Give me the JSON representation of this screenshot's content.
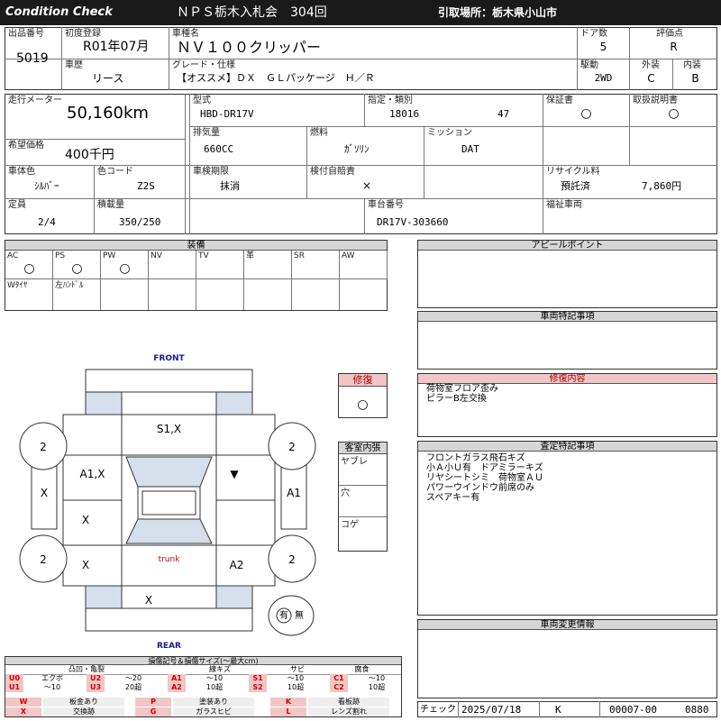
{
  "header": {
    "title": "Condition  Check",
    "auction": "ＮＰＳ栃木入札会　304回",
    "pickup": "引取場所：栃木県小山市"
  },
  "top": {
    "lot_label": "出品番号",
    "lot": "5019",
    "reg_label": "初度登録",
    "reg": "R01年07月",
    "name_label": "車種名",
    "name": "ＮＶ１００クリッパー",
    "doors_label": "ドア数",
    "doors": "5",
    "grade_score_label": "評価点",
    "grade_score": "R",
    "history_label": "車歴",
    "history": "リース",
    "grade_label": "グレード・仕様",
    "grade": "【オススメ】ＤＸ　ＧＬパッケージ　Ｈ／Ｒ",
    "drive_label": "駆動",
    "drive": "2WD",
    "exterior_label": "外装",
    "exterior": "C",
    "interior_label": "内装",
    "interior": "B"
  },
  "mid": {
    "mileage_label": "走行メーター",
    "mileage": "50,160km",
    "price_label": "希望価格",
    "price": "400千円",
    "model_label": "型式",
    "model": "HBD-DR17V",
    "designation_label": "指定・類別",
    "designation": "18016",
    "category": "47",
    "warranty_label": "保証書",
    "warranty": "○",
    "manual_label": "取扱説明書",
    "manual": "○",
    "displacement_label": "排気量",
    "displacement": "660CC",
    "fuel_label": "燃料",
    "fuel": "ｶﾞｿﾘﾝ",
    "mission_label": "ミッション",
    "mission": "DAT",
    "color_label": "車体色",
    "color": "ｼﾙﾊﾞｰ",
    "colorcode_label": "色コード",
    "colorcode": "Z2S",
    "inspection_label": "車検期限",
    "inspection": "抹消",
    "insurance_label": "検付自賠責",
    "insurance": "×",
    "recycle_label": "リサイクル料",
    "recycle_status": "預託済",
    "recycle_fee": "7,860円",
    "capacity_label": "定員",
    "capacity": "2/4",
    "load_label": "積載量",
    "load": "350/250",
    "chassis_label": "車台番号",
    "chassis": "DR17V-303660",
    "welfare_label": "福祉車両"
  },
  "equipment": {
    "title": "装備",
    "items": [
      {
        "label": "AC",
        "value": "○"
      },
      {
        "label": "PS",
        "value": "○"
      },
      {
        "label": "PW",
        "value": "○"
      },
      {
        "label": "NV",
        "value": ""
      },
      {
        "label": "TV",
        "value": ""
      },
      {
        "label": "革",
        "value": ""
      },
      {
        "label": "SR",
        "value": ""
      },
      {
        "label": "AW",
        "value": ""
      }
    ],
    "row2": [
      "Wﾀｲﾔ",
      "左ﾊﾝﾄﾞﾙ"
    ]
  },
  "diagram": {
    "front": "FRONT",
    "rear": "REAR",
    "trunk": "trunk",
    "tires": [
      "2",
      "2",
      "2",
      "2"
    ],
    "marks": {
      "hood": "S1,X",
      "left_front": "A1,X",
      "left_door": "X",
      "left_rear": "X",
      "left_fender_front": "X",
      "right_front": "▼",
      "right_door": "A1",
      "right_rear": "A2",
      "rear_panel": "X"
    },
    "repair_label": "修復",
    "repair_value": "○",
    "cabin_label": "客室内張",
    "cabin_items": [
      "ヤブレ",
      "穴",
      "コゲ"
    ],
    "stamp": "有",
    "stamp_alt": "無"
  },
  "right": {
    "appeal_title": "アピールポイント",
    "special_title": "車両特記事項",
    "repair_title": "修復内容",
    "repair_lines": [
      "荷物室フロア歪み",
      "ピラーB左交換"
    ],
    "inspector_title": "査定特記事項",
    "inspector_lines": [
      "フロントガラス飛石キズ",
      "小Ａ小Ｕ有　ドアミラーキズ",
      "リヤシートシミ　荷物室ＡＵ",
      "パワーウインドウ前席のみ",
      "スペアキー有"
    ],
    "change_title": "車両変更情報"
  },
  "legend": {
    "title": "損傷記号＆損傷サイズ(〜最大cm)",
    "groups": [
      "凸凹・亀裂",
      "線キズ",
      "サビ",
      "腐食"
    ],
    "rows": [
      [
        {
          "c": "U0",
          "t": "エクボ"
        },
        {
          "c": "U2",
          "t": "〜20"
        },
        {
          "c": "A1",
          "t": "〜10"
        },
        {
          "c": "S1",
          "t": "〜10"
        },
        {
          "c": "C1",
          "t": "〜10"
        }
      ],
      [
        {
          "c": "U1",
          "t": "〜10"
        },
        {
          "c": "U3",
          "t": "20超"
        },
        {
          "c": "A2",
          "t": "10超"
        },
        {
          "c": "S2",
          "t": "10超"
        },
        {
          "c": "C2",
          "t": "10超"
        }
      ]
    ],
    "others": [
      [
        {
          "c": "W",
          "t": "板金あり"
        },
        {
          "c": "P",
          "t": "塗装あり"
        },
        {
          "c": "K",
          "t": "看板跡"
        }
      ],
      [
        {
          "c": "X",
          "t": "交換跡"
        },
        {
          "c": "G",
          "t": "ガラスヒビ"
        },
        {
          "c": "L",
          "t": "レンズ割れ"
        }
      ]
    ]
  },
  "footer": {
    "check_label": "チェック",
    "date": "2025/07/18",
    "checker": "K",
    "code1": "00007-00",
    "code2": "0880"
  }
}
